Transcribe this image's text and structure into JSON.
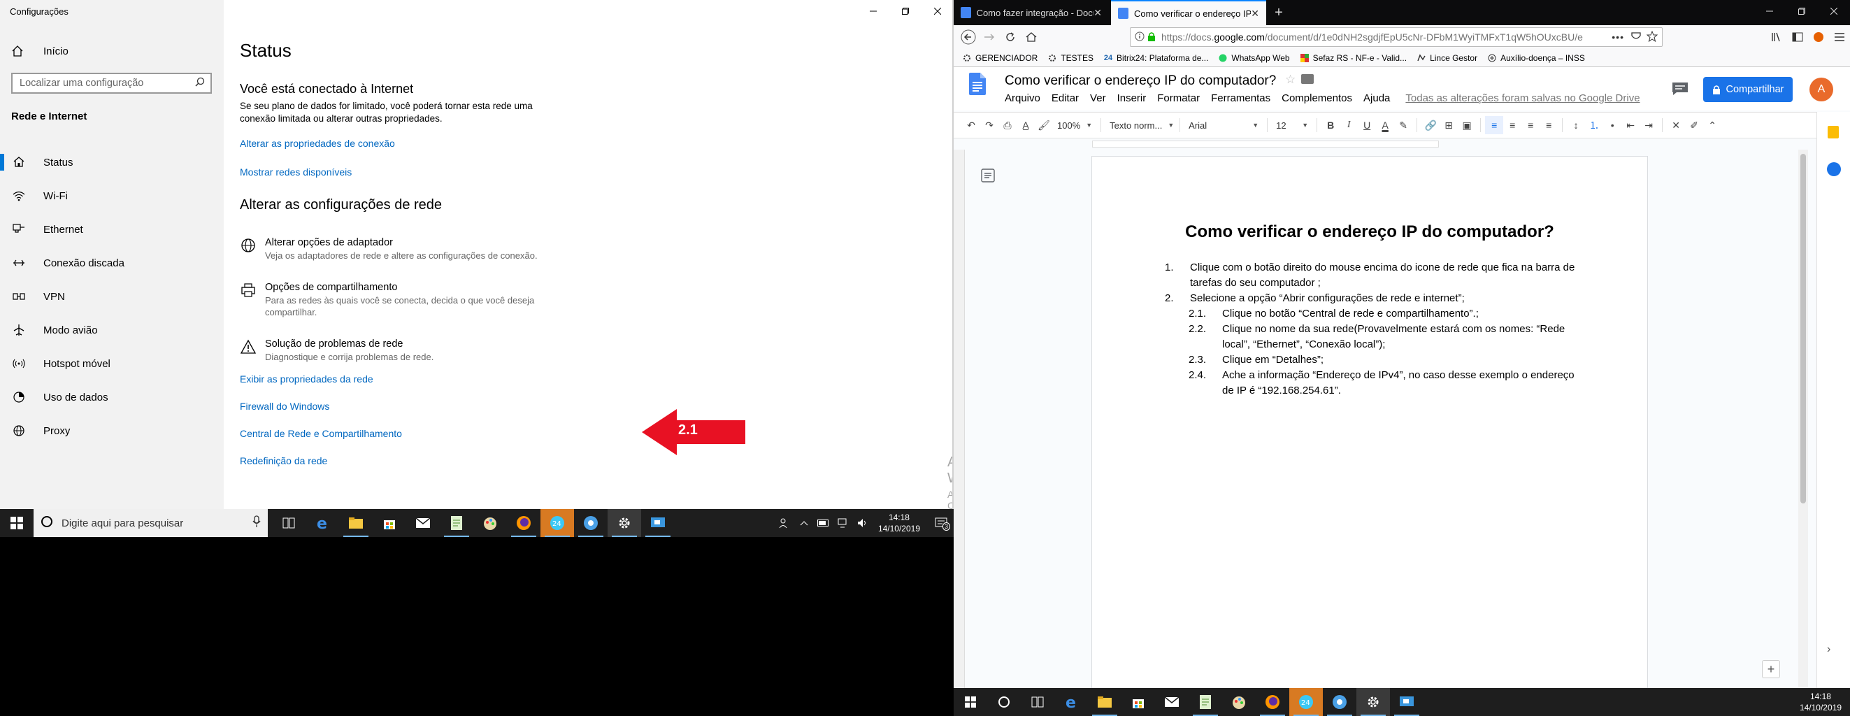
{
  "settings": {
    "window_title": "Configurações",
    "home_label": "Início",
    "search_placeholder": "Localizar uma configuração",
    "section_title": "Rede e Internet",
    "nav": [
      {
        "label": "Status",
        "icon": "home-network-icon"
      },
      {
        "label": "Wi-Fi",
        "icon": "wifi-icon"
      },
      {
        "label": "Ethernet",
        "icon": "ethernet-icon"
      },
      {
        "label": "Conexão discada",
        "icon": "dialup-icon"
      },
      {
        "label": "VPN",
        "icon": "vpn-icon"
      },
      {
        "label": "Modo avião",
        "icon": "airplane-icon"
      },
      {
        "label": "Hotspot móvel",
        "icon": "hotspot-icon"
      },
      {
        "label": "Uso de dados",
        "icon": "data-usage-icon"
      },
      {
        "label": "Proxy",
        "icon": "globe-icon"
      }
    ],
    "page_title": "Status",
    "connected_heading": "Você está conectado à Internet",
    "connected_desc": "Se seu plano de dados for limitado, você poderá tornar esta rede uma conexão limitada ou alterar outras propriedades.",
    "link_props": "Alterar as propriedades de conexão",
    "link_networks": "Mostrar redes disponíveis",
    "change_heading": "Alterar as configurações de rede",
    "options": [
      {
        "title": "Alterar opções de adaptador",
        "desc": "Veja os adaptadores de rede e altere as configurações de conexão."
      },
      {
        "title": "Opções de compartilhamento",
        "desc": "Para as redes às quais você se conecta, decida o que você deseja compartilhar."
      },
      {
        "title": "Solução de problemas de rede",
        "desc": "Diagnostique e corrija problemas de rede."
      }
    ],
    "links": [
      "Exibir as propriedades da rede",
      "Firewall do Windows",
      "Central de Rede e Compartilhamento",
      "Redefinição da rede"
    ],
    "arrow_label": "2.1",
    "activate_title": "Ativar o Windows",
    "activate_desc": "Acesse Configurações para ativar o Windows.",
    "arrow_color": "#e81123",
    "accent": "#0078d7"
  },
  "taskbar": {
    "search_placeholder": "Digite aqui para pesquisar",
    "time": "14:18",
    "date": "14/10/2019",
    "notif_count": "3"
  },
  "browser": {
    "tabs": [
      {
        "title": "Como fazer integração - Docum",
        "selected": false
      },
      {
        "title": "Como verificar o endereço IP d",
        "selected": true
      }
    ],
    "url_prefix": "https://docs.",
    "url_domain": "google.com",
    "url_rest": "/document/d/1e0dNH2sgdjfEpU5cNr-DFbM1WyiTMFxT1qW5hOUxcBU/e",
    "bookmarks": [
      {
        "label": "GERENCIADOR",
        "icon": "gear-icon"
      },
      {
        "label": "TESTES",
        "icon": "gear-icon"
      },
      {
        "label": "Bitrix24: Plataforma de...",
        "icon": "bitrix-icon"
      },
      {
        "label": "WhatsApp Web",
        "icon": "whatsapp-icon"
      },
      {
        "label": "Sefaz RS - NF-e - Valid...",
        "icon": "sefaz-icon"
      },
      {
        "label": "Lince Gestor",
        "icon": "lince-icon"
      },
      {
        "label": "Auxílio-doença – INSS",
        "icon": "inss-icon"
      }
    ]
  },
  "docs": {
    "title": "Como verificar o endereço IP do computador?",
    "menu": [
      "Arquivo",
      "Editar",
      "Ver",
      "Inserir",
      "Formatar",
      "Ferramentas",
      "Complementos",
      "Ajuda"
    ],
    "saved_status": "Todas as alterações foram salvas no Google Drive",
    "share_label": "Compartilhar",
    "avatar_letter": "A",
    "zoom": "100%",
    "style": "Texto norm...",
    "font": "Arial",
    "size": "12",
    "heading": "Como verificar o endereço IP do computador?",
    "items": [
      {
        "num": "1.",
        "text": "Clique com o botão direito do mouse encima do icone de rede que fica na barra de tarefas do seu computador ;",
        "level": 1
      },
      {
        "num": "2.",
        "text": "Selecione a opção “Abrir configurações de rede e internet”;",
        "level": 1
      },
      {
        "num": "2.1.",
        "text": "Clique no botão “Central de rede e compartilhamento”.;",
        "level": 2
      },
      {
        "num": "2.2.",
        "text": "Clique no nome da sua rede(Provavelmente estará com os nomes: “Rede local”, “Ethernet”, “Conexão local”);",
        "level": 2
      },
      {
        "num": "2.3.",
        "text": "Clique em “Detalhes”;",
        "level": 2
      },
      {
        "num": "2.4.",
        "text": "Ache a informação “Endereço de IPv4”, no caso desse exemplo o endereço de IP é “192.168.254.61”.",
        "level": 2
      }
    ],
    "share_color": "#1a73e8",
    "avatar_color": "#e96a2b"
  }
}
